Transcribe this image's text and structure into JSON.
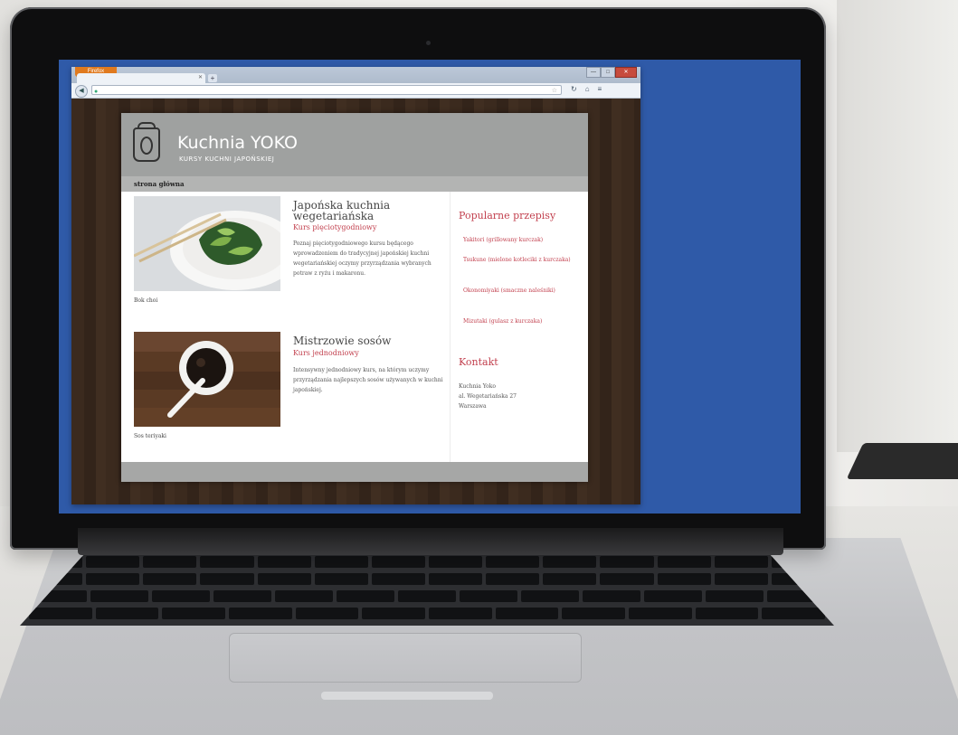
{
  "browser": {
    "menu_button": "Firefox",
    "tab_title": "",
    "new_tab": "+",
    "url": "",
    "min": "—",
    "max": "□",
    "close": "✕"
  },
  "site": {
    "title": "Kuchnia YOKO",
    "subtitle": "KURSY KUCHNI JAPOŃSKIEJ",
    "menu": [
      {
        "label": "strona główna",
        "active": true
      },
      {
        "label": "",
        "active": false
      },
      {
        "label": "",
        "active": false
      },
      {
        "label": "",
        "active": false
      },
      {
        "label": "",
        "active": false
      }
    ],
    "articles": [
      {
        "image": "bok-choi-photo",
        "caption": "Bok choi",
        "title": "Japońska kuchnia wegetariańska",
        "subtitle": "Kurs pięciotygodniowy",
        "body": "Poznaj pięciotygodniowego kursu będącego wprowadzeniem do tradycyjnej japońskiej kuchni wegetariańskiej oczymy przyrządzania wybranych potraw z ryżu i makaronu."
      },
      {
        "image": "teriyaki-sauce-photo",
        "caption": "Sos teriyaki",
        "title": "Mistrzowie sosów",
        "subtitle": "Kurs jednodniowy",
        "body": "Intensywny jednodniowy kurs, na którym uczymy przyrządzania najlepszych sosów używanych w kuchni japońskiej."
      }
    ],
    "sidebar": {
      "popular_heading": "Popularne przepisy",
      "recipes": [
        "Yakitori (grillowany kurczak)",
        "Tsukune (mielone kotleciki z kurczaka)",
        "Okonomiyaki (smaczne naleśniki)",
        "Mizutaki (gulasz z kurczaka)"
      ],
      "contact_heading": "Kontakt",
      "contact_lines": [
        "Kuchnia Yoko",
        "al. Wegetariańska 27",
        "Warszawa"
      ]
    },
    "footer": ""
  },
  "colors": {
    "accent": "#c2404e",
    "header": "#9fa1a0",
    "desktop": "#2f5aa8"
  }
}
